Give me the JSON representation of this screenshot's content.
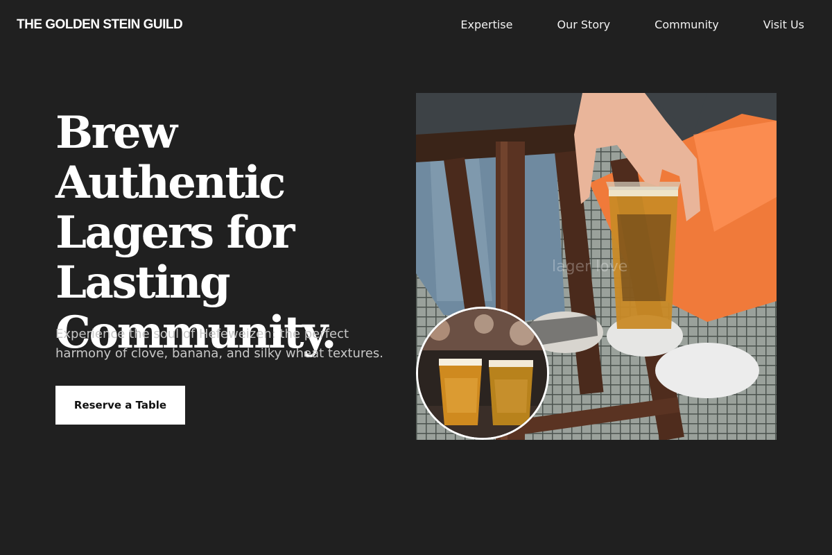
{
  "header": {
    "brand": "THE GOLDEN STEIN GUILD",
    "nav": [
      {
        "label": "Expertise"
      },
      {
        "label": "Our Story"
      },
      {
        "label": "Community"
      },
      {
        "label": "Visit Us"
      }
    ]
  },
  "hero": {
    "title_lines": [
      "Brew Authentic",
      "Lagers for",
      "Lasting",
      "Community."
    ],
    "subtitle": "Experience the soul of Hefeweizen: the perfect harmony of clove, banana, and silky wheat textures.",
    "cta_label": "Reserve a Table",
    "main_photo": {
      "watermark": "lager love"
    }
  },
  "colors": {
    "background": "#202020",
    "text": "#ffffff",
    "subtitle": "#c8c8c8",
    "button_bg": "#ffffff",
    "button_text": "#111111",
    "pants_orange": "#ff7f3a",
    "beer_amber": "#c98a26"
  }
}
